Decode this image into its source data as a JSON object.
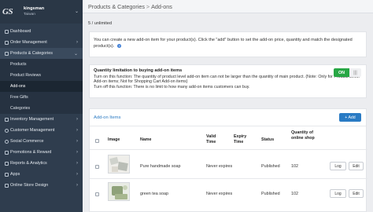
{
  "sidebar": {
    "logo": "GS",
    "store_name": "kingsman",
    "store_sub": "Taiwan",
    "items": [
      {
        "label": "Dashboard",
        "icon": "dashboard-icon"
      },
      {
        "label": "Order Management",
        "icon": "orders-icon"
      },
      {
        "label": "Products & Categories",
        "icon": "products-icon"
      },
      {
        "label": "Inventory Management",
        "icon": "inventory-icon"
      },
      {
        "label": "Customer Management",
        "icon": "customers-icon"
      },
      {
        "label": "Social Commerce",
        "icon": "social-icon"
      },
      {
        "label": "Promotions & Reward",
        "icon": "promotions-icon"
      },
      {
        "label": "Reports & Analytics",
        "icon": "reports-icon"
      },
      {
        "label": "Apps",
        "icon": "apps-icon"
      },
      {
        "label": "Online Store Design",
        "icon": "design-icon"
      }
    ],
    "sub_items": [
      {
        "label": "Products"
      },
      {
        "label": "Product Reviews"
      },
      {
        "label": "Add-ons"
      },
      {
        "label": "Free Gifts"
      },
      {
        "label": "Categories"
      }
    ]
  },
  "header": {
    "crumb_parent": "Products & Categories",
    "crumb_sep": ">",
    "crumb_current": "Add-ons"
  },
  "limit_text": "5 / unlimited",
  "intro": {
    "text": "You can create a new add-on item for your product(s). Click the \"add\" button to set the add-on price, quantity and match the designated product(s)."
  },
  "quantity_limit": {
    "title": "Quantity limitation to buying add-on items",
    "line1": "Turn on this function: The quantity of product level add-on item can not be larger than the quantity of main product. (Note: Only for Product Level Add-on items; Not for Shopping Cart Add-on items)",
    "line2": "Turn off this function: There is no limit to how many add-on items customers can buy.",
    "toggle_on": "ON",
    "toggle_off_icon": "|||"
  },
  "addon_items": {
    "title": "Add-on Items",
    "add_button": "+ Add",
    "columns": [
      "Image",
      "Name",
      "Valid Time",
      "Expiry Time",
      "Status",
      "Quantity of online shop"
    ],
    "rows": [
      {
        "name": "Pure handmade soap",
        "valid": "",
        "expiry": "Never expires",
        "status": "Published",
        "qty": "102",
        "log": "Log",
        "edit": "Edit"
      },
      {
        "name": "green tea soap",
        "valid": "",
        "expiry": "Never expires",
        "status": "Published",
        "qty": "102",
        "log": "Log",
        "edit": "Edit"
      }
    ]
  },
  "colors": {
    "sidebar_bg": "#2f3d4e",
    "accent_blue": "#2a7bc4",
    "toggle_green": "#28a745"
  }
}
